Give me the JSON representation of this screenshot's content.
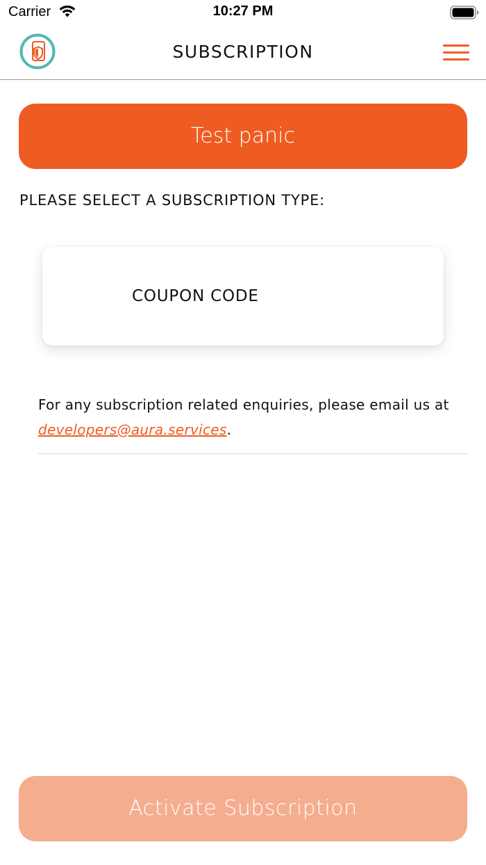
{
  "status_bar": {
    "carrier": "Carrier",
    "time": "10:27 PM",
    "wifi_icon": "wifi-icon",
    "battery_icon": "battery-icon"
  },
  "header": {
    "title": "SUBSCRIPTION",
    "logo_icon": "shield-phone-logo",
    "menu_icon": "hamburger-menu-icon"
  },
  "main": {
    "test_panic_label": "Test panic",
    "select_prompt": "PLEASE SELECT A SUBSCRIPTION TYPE:",
    "coupon_option_label": "COUPON CODE",
    "enquiry_text_before": "For any subscription related enquiries, please email us at ",
    "enquiry_email": "developers@aura.services",
    "enquiry_text_after": "."
  },
  "footer": {
    "activate_label": "Activate Subscription",
    "activate_enabled": false
  },
  "colors": {
    "accent": "#ee5c22",
    "accent_disabled": "#f5ad8f",
    "logo_ring": "#4fb8b4"
  }
}
